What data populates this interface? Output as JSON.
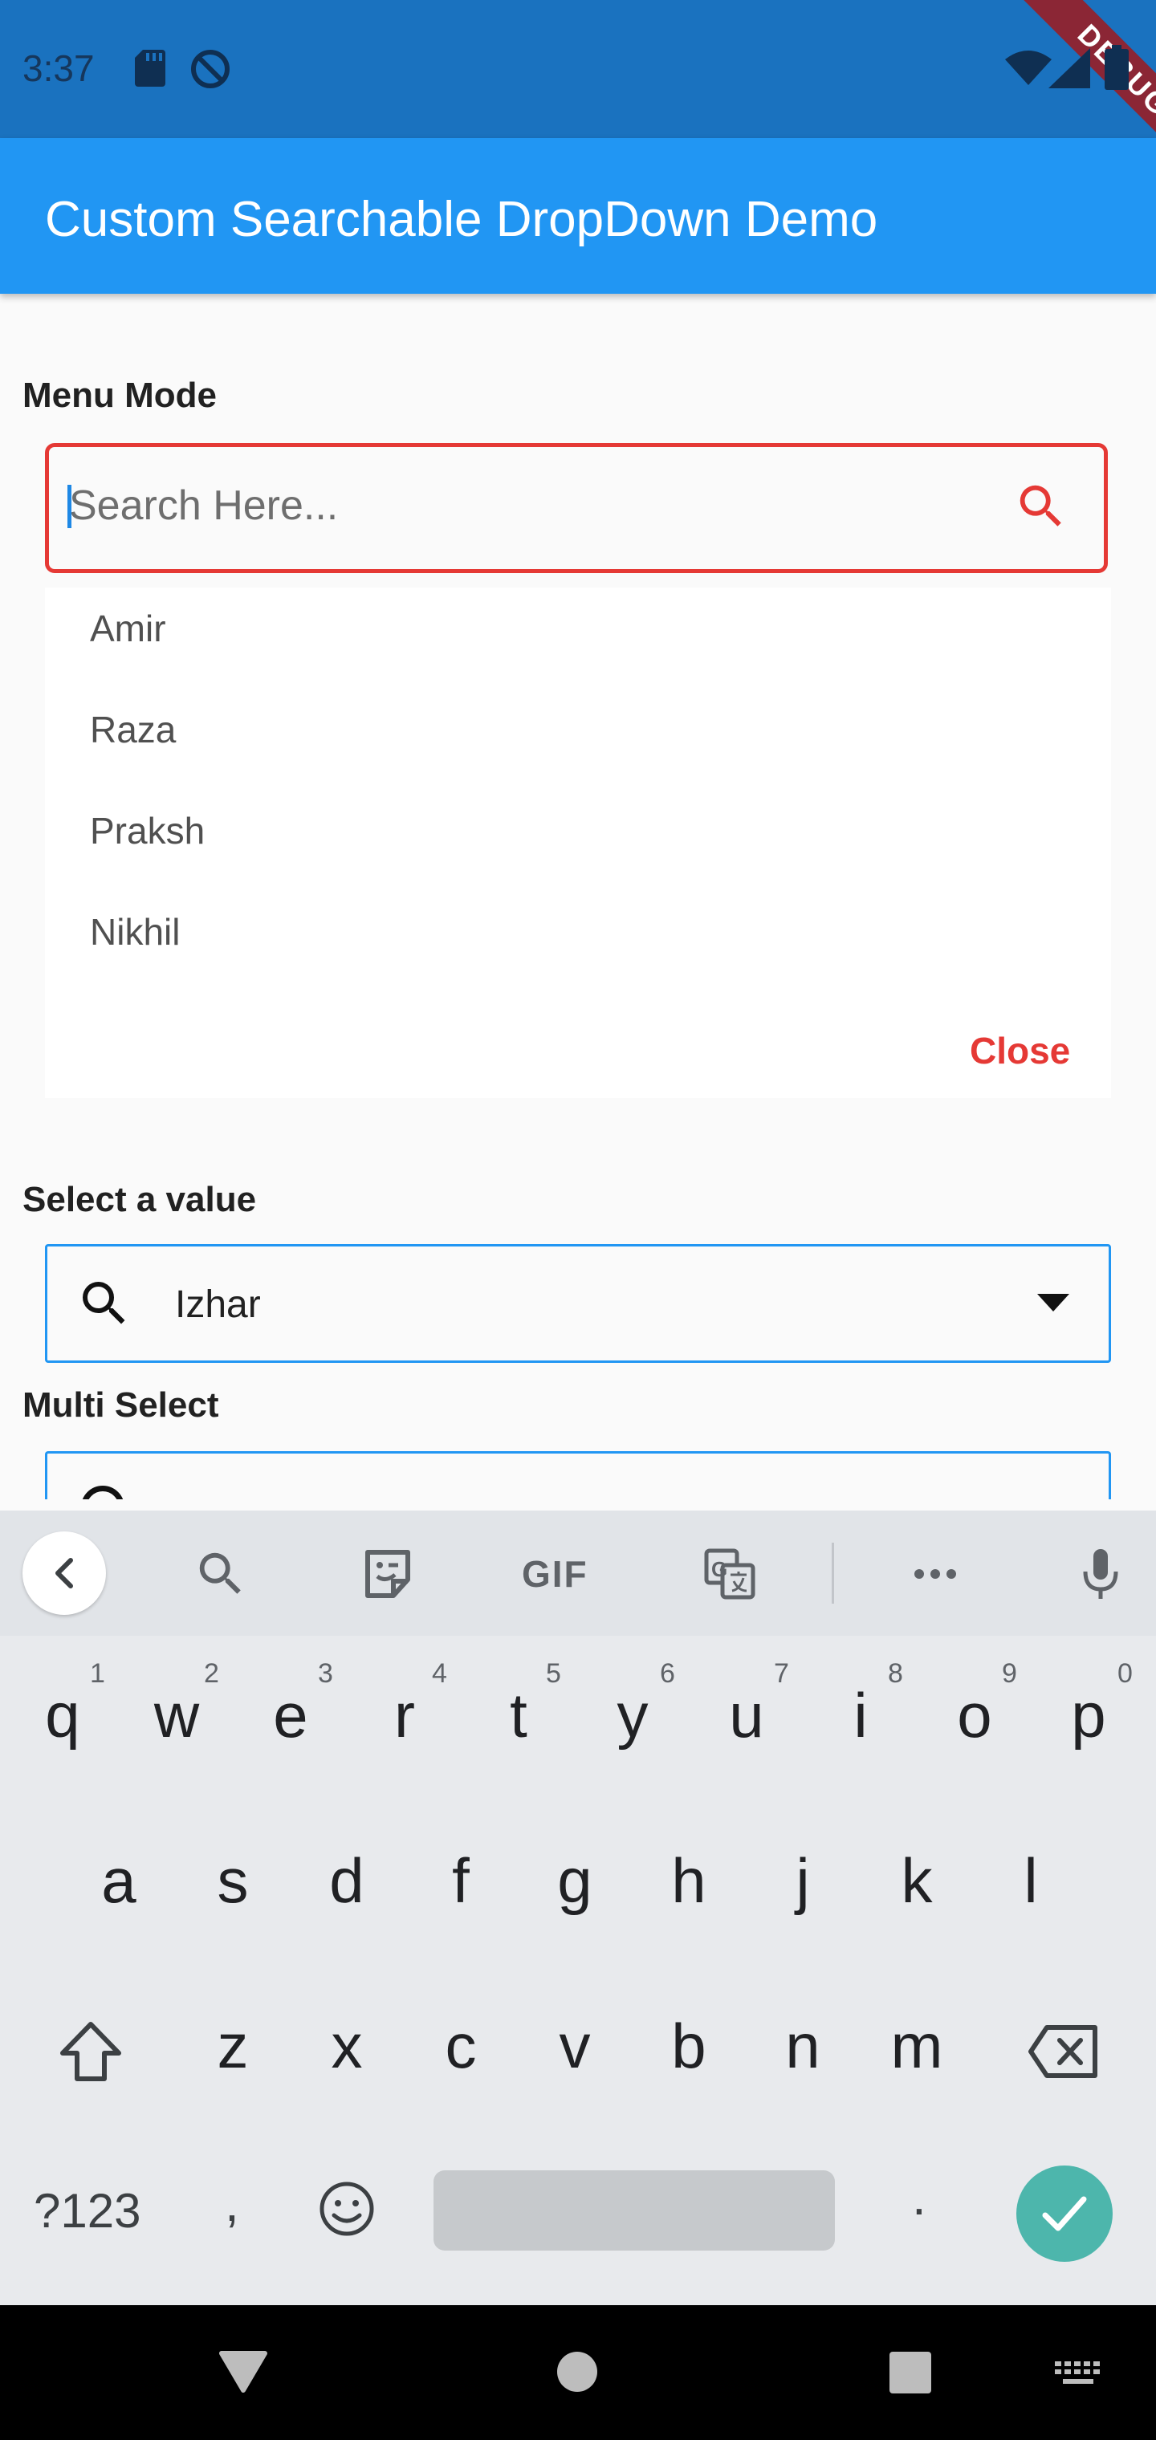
{
  "status_bar": {
    "time": "3:37",
    "icons": [
      "sd-card-icon",
      "do-not-disturb-icon",
      "wifi-icon",
      "signal-icon",
      "battery-icon"
    ],
    "debug_banner": "DEBUG",
    "color": "#1a72bf"
  },
  "app_bar": {
    "title": "Custom Searchable DropDown Demo",
    "color": "#2196f3"
  },
  "menu_mode": {
    "label": "Menu Mode",
    "search": {
      "placeholder": "Search Here...",
      "value": ""
    },
    "items": [
      "Amir",
      "Raza",
      "Praksh",
      "Nikhil"
    ],
    "close_label": "Close",
    "accent": "#e53935"
  },
  "select_value": {
    "label": "Select a value",
    "value": "Izhar"
  },
  "multi_select": {
    "label": "Multi Select"
  },
  "keyboard": {
    "toolbar_icons": [
      "back-icon",
      "search-icon",
      "sticker-icon",
      "gif-icon",
      "translate-icon",
      "more-icon",
      "mic-icon"
    ],
    "gif_label": "GIF",
    "row1": [
      "q",
      "w",
      "e",
      "r",
      "t",
      "y",
      "u",
      "i",
      "o",
      "p"
    ],
    "row1_hints": [
      "1",
      "2",
      "3",
      "4",
      "5",
      "6",
      "7",
      "8",
      "9",
      "0"
    ],
    "row2": [
      "a",
      "s",
      "d",
      "f",
      "g",
      "h",
      "j",
      "k",
      "l"
    ],
    "row3": [
      "z",
      "x",
      "c",
      "v",
      "b",
      "n",
      "m"
    ],
    "symbols_label": "?123",
    "comma": ",",
    "period": ".",
    "enter_color": "#4db6ac"
  },
  "nav_bar": {
    "icons": [
      "back-triangle-icon",
      "home-circle-icon",
      "recents-square-icon",
      "keyboard-switch-icon"
    ]
  }
}
